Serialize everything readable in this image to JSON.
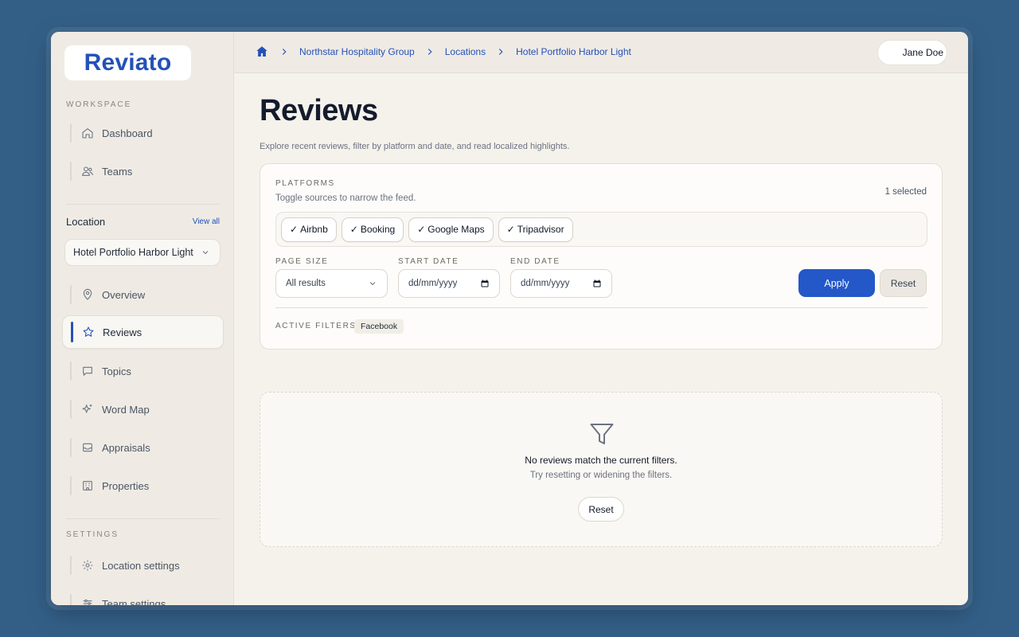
{
  "app": {
    "logo": "Reviato"
  },
  "sidebar": {
    "workspace_label": "WORKSPACE",
    "workspace_items": [
      {
        "label": "Dashboard",
        "icon": "home-icon"
      },
      {
        "label": "Teams",
        "icon": "users-icon"
      }
    ],
    "location_title": "Location",
    "view_all": "View all",
    "location_select": "Hotel Portfolio Harbor Light",
    "location_items": [
      {
        "label": "Overview",
        "icon": "pin-icon"
      },
      {
        "label": "Reviews",
        "icon": "star-icon",
        "active": true
      },
      {
        "label": "Topics",
        "icon": "chat-icon"
      },
      {
        "label": "Word Map",
        "icon": "sparkle-icon"
      },
      {
        "label": "Appraisals",
        "icon": "inbox-icon"
      },
      {
        "label": "Properties",
        "icon": "building-icon"
      }
    ],
    "settings_label": "SETTINGS",
    "settings_items": [
      {
        "label": "Location settings",
        "icon": "gear-icon"
      },
      {
        "label": "Team settings",
        "icon": "sliders-icon"
      }
    ]
  },
  "breadcrumb": {
    "items": [
      "Northstar Hospitality Group",
      "Locations",
      "Hotel Portfolio Harbor Light"
    ]
  },
  "user": {
    "name": "Jane Doe"
  },
  "page": {
    "title": "Reviews",
    "subtitle": "Explore recent reviews, filter by platform and date, and read localized highlights."
  },
  "filters": {
    "platforms_label": "PLATFORMS",
    "platforms_desc": "Toggle sources to narrow the feed.",
    "selected_count": "1 selected",
    "platforms": [
      "Airbnb",
      "Booking",
      "Google Maps",
      "Tripadvisor"
    ],
    "check": "✓",
    "page_size_label": "PAGE SIZE",
    "page_size_value": "All results",
    "start_date_label": "START DATE",
    "start_date_value": "dd/mm/yyyy",
    "end_date_label": "END DATE",
    "end_date_value": "dd/mm/yyyy",
    "apply": "Apply",
    "reset": "Reset",
    "active_filters_label": "ACTIVE FILTERS",
    "active_filters": [
      "Facebook"
    ]
  },
  "empty_state": {
    "title": "No reviews match the current filters.",
    "subtitle": "Try resetting or widening the filters.",
    "reset": "Reset"
  },
  "colors": {
    "accent": "#2451b7",
    "apply_bg": "#2457c8",
    "page_bg": "#335f87"
  }
}
